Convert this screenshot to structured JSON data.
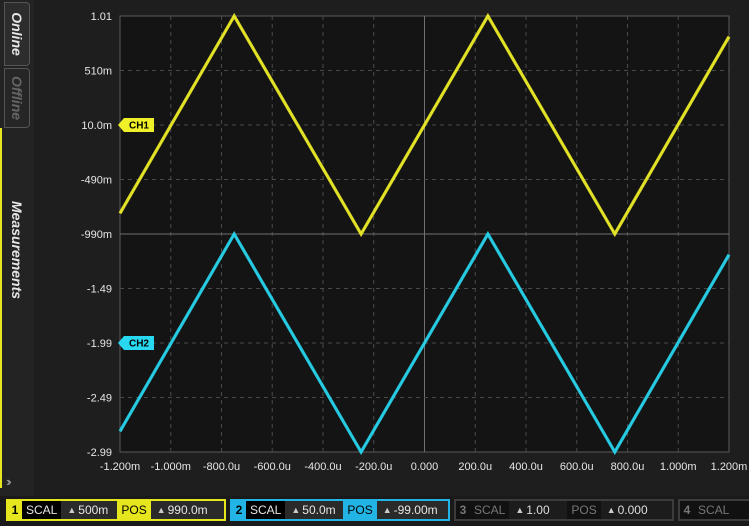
{
  "side_tabs": {
    "online": "Online",
    "offline": "Offline",
    "measurements": "Measurements"
  },
  "chart_data": {
    "type": "line",
    "xlim": [
      -1.2,
      1.2
    ],
    "x_unit": "ms",
    "ylim": [
      -2.99,
      1.01
    ],
    "x_tick_labels": [
      "-1.200m",
      "-1.000m",
      "-800.0u",
      "-600.0u",
      "-400.0u",
      "-200.0u",
      "0.000",
      "200.0u",
      "400.0u",
      "600.0u",
      "800.0u",
      "1.000m",
      "1.200m"
    ],
    "y_tick_labels": [
      "1.01",
      "510m",
      "10.0m",
      "-490m",
      "-990m",
      "-1.49",
      "-1.99",
      "-2.49",
      "-2.99"
    ],
    "grid": true,
    "series": [
      {
        "name": "CH1",
        "color": "#f0f028",
        "marker_level": 0.01,
        "x": [
          -1.2,
          -0.75,
          -0.25,
          0.25,
          0.75,
          1.2
        ],
        "y": [
          -0.8,
          1.01,
          -0.99,
          1.01,
          -0.99,
          0.82
        ]
      },
      {
        "name": "CH2",
        "color": "#28d7f0",
        "marker_level": -1.99,
        "x": [
          -1.2,
          -0.75,
          -0.25,
          0.25,
          0.75,
          1.2
        ],
        "y": [
          -2.8,
          -0.99,
          -2.99,
          -0.99,
          -2.99,
          -1.18
        ]
      }
    ]
  },
  "bottom_bar": {
    "ch1": {
      "num": "1",
      "scale_label": "SCAL",
      "scale_value": "500m",
      "pos_label": "POS",
      "pos_value": "990.0m"
    },
    "ch2": {
      "num": "2",
      "scale_label": "SCAL",
      "scale_value": "50.0m",
      "pos_label": "POS",
      "pos_value": "-99.00m"
    },
    "ch3": {
      "num": "3",
      "scale_label": "SCAL",
      "scale_value": "1.00",
      "pos_label": "POS",
      "pos_value": "0.000"
    },
    "ch4": {
      "num": "4",
      "scale_label": "SCAL"
    }
  },
  "icons": {
    "expand": "double-chevron-right-icon",
    "spin": "up-down-arrows-icon"
  }
}
